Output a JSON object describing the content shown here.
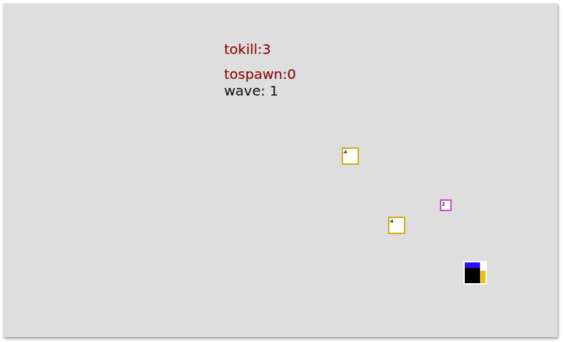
{
  "hud": {
    "tokill": "tokill:3",
    "tospawn": "tospawn:0",
    "wave": "wave: 1"
  },
  "enemies": [
    {
      "hp": "4",
      "kind": "large",
      "color": "#d4aa00"
    },
    {
      "hp": "2",
      "kind": "small",
      "color": "#cc44cc"
    },
    {
      "hp": "4",
      "kind": "large",
      "color": "#d4aa00"
    }
  ],
  "player": {
    "shield": {
      "level": 1
    },
    "energy": {
      "level": 0.6
    }
  }
}
